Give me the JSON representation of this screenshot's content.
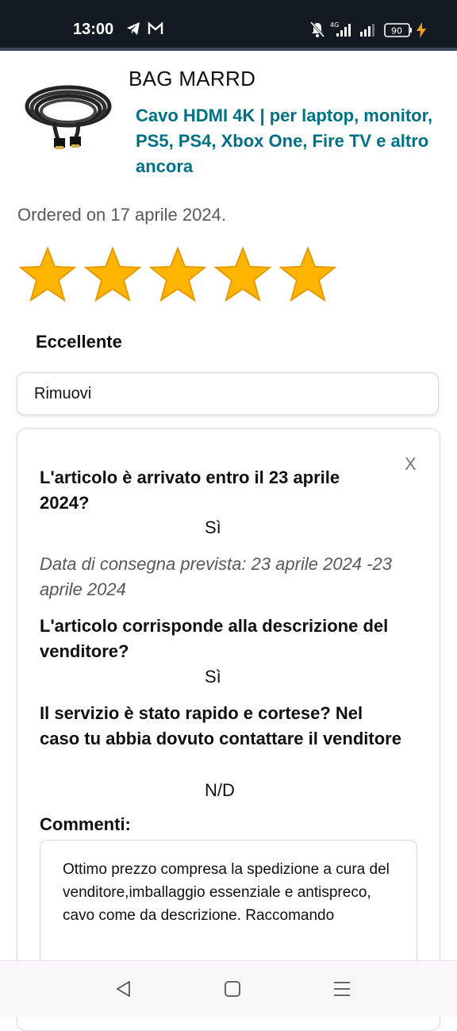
{
  "status_bar": {
    "time": "13:00",
    "battery": "90",
    "icons": [
      "telegram-icon",
      "gmail-icon",
      "mute-icon",
      "4g-signal-icon",
      "signal-icon",
      "battery-icon",
      "charging-icon"
    ]
  },
  "product": {
    "seller": "BAG MARRD",
    "title": "Cavo HDMI 4K | per laptop, monitor, PS5, PS4, Xbox One, Fire TV e altro ancora",
    "image_icon": "hdmi-cable-image"
  },
  "order": {
    "ordered_text": "Ordered on 17 aprile 2024."
  },
  "rating": {
    "stars": 5,
    "max_stars": 5,
    "label": "Eccellente",
    "star_color": "#ffb400"
  },
  "remove_button_label": "Rimuovi",
  "feedback": {
    "close_label": "X",
    "q1": "L'articolo è arrivato entro il 23 aprile 2024?",
    "a1": "Sì",
    "expected_delivery": "Data di consegna prevista: 23 aprile 2024 -23 aprile 2024",
    "q2": "L'articolo corrisponde alla descrizione del venditore?",
    "a2": "Sì",
    "q3": "Il servizio è stato rapido e cortese? Nel caso tu abbia dovuto contattare il venditore",
    "a3": "N/D",
    "comments_label": "Commenti:",
    "comment": "Ottimo prezzo compresa la spedizione a cura del venditore,imballaggio essenziale e antispreco, cavo come da descrizione. Raccomando"
  },
  "colors": {
    "status_bar": "#131a22",
    "link": "#007185",
    "text": "#0f1111",
    "muted": "#565959"
  },
  "nav_bar": {
    "icons": [
      "back-icon",
      "home-icon",
      "menu-icon"
    ]
  }
}
